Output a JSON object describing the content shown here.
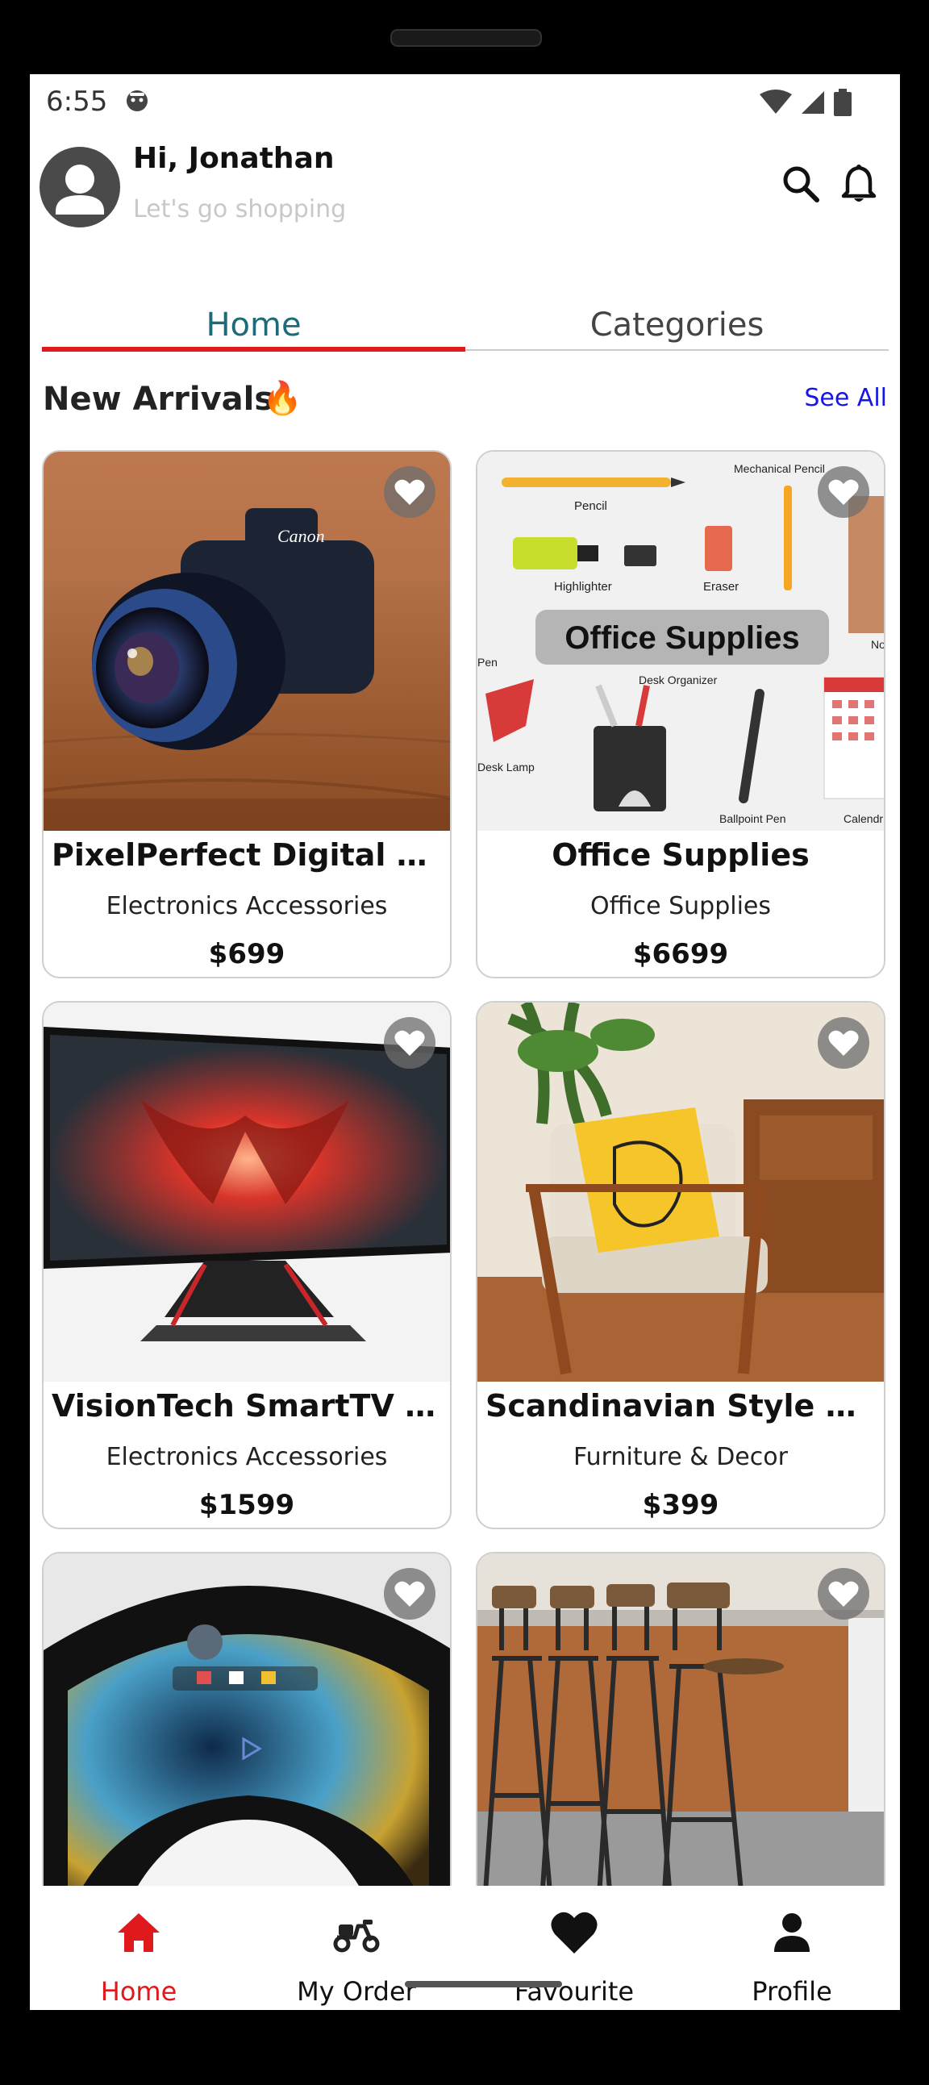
{
  "status_bar": {
    "time": "6:55"
  },
  "header": {
    "greeting": "Hi, Jonathan",
    "subtitle": "Let's go shopping"
  },
  "tabs": [
    {
      "label": "Home",
      "active": true
    },
    {
      "label": "Categories",
      "active": false
    }
  ],
  "section": {
    "title": "New Arrivals",
    "emoji": "🔥",
    "see_all": "See All"
  },
  "products": [
    {
      "title": "PixelPerfect Digital Ca…",
      "category": "Electronics Accessories",
      "price": "$699"
    },
    {
      "title": "Office Supplies",
      "category": "Office Supplies",
      "price": "$6699",
      "image_labels": {
        "banner": "Office Supplies",
        "pencil": "Pencil",
        "mechanical": "Mechanical Pencil",
        "highlighter": "Highlighter",
        "eraser": "Eraser",
        "pen": "Pen",
        "desk_lamp": "Desk Lamp",
        "organizer": "Desk Organizer",
        "ballpoint": "Ballpoint Pen",
        "calendar": "Calendr",
        "note": "No"
      }
    },
    {
      "title": "VisionTech SmartTV X…",
      "category": "Electronics Accessories",
      "price": "$1599"
    },
    {
      "title": "Scandinavian Style Ar…",
      "category": "Furniture & Decor",
      "price": "$399"
    },
    {
      "title": "",
      "category": "",
      "price": ""
    },
    {
      "title": "",
      "category": "",
      "price": ""
    }
  ],
  "bottom_nav": [
    {
      "label": "Home",
      "icon": "home-icon",
      "active": true
    },
    {
      "label": "My Order",
      "icon": "scooter-icon",
      "active": false
    },
    {
      "label": "Favourite",
      "icon": "heart-icon",
      "active": false
    },
    {
      "label": "Profile",
      "icon": "person-icon",
      "active": false
    }
  ],
  "colors": {
    "accent": "#e0191d",
    "tab_active_text": "#1e6a78",
    "link": "#1616e6"
  }
}
